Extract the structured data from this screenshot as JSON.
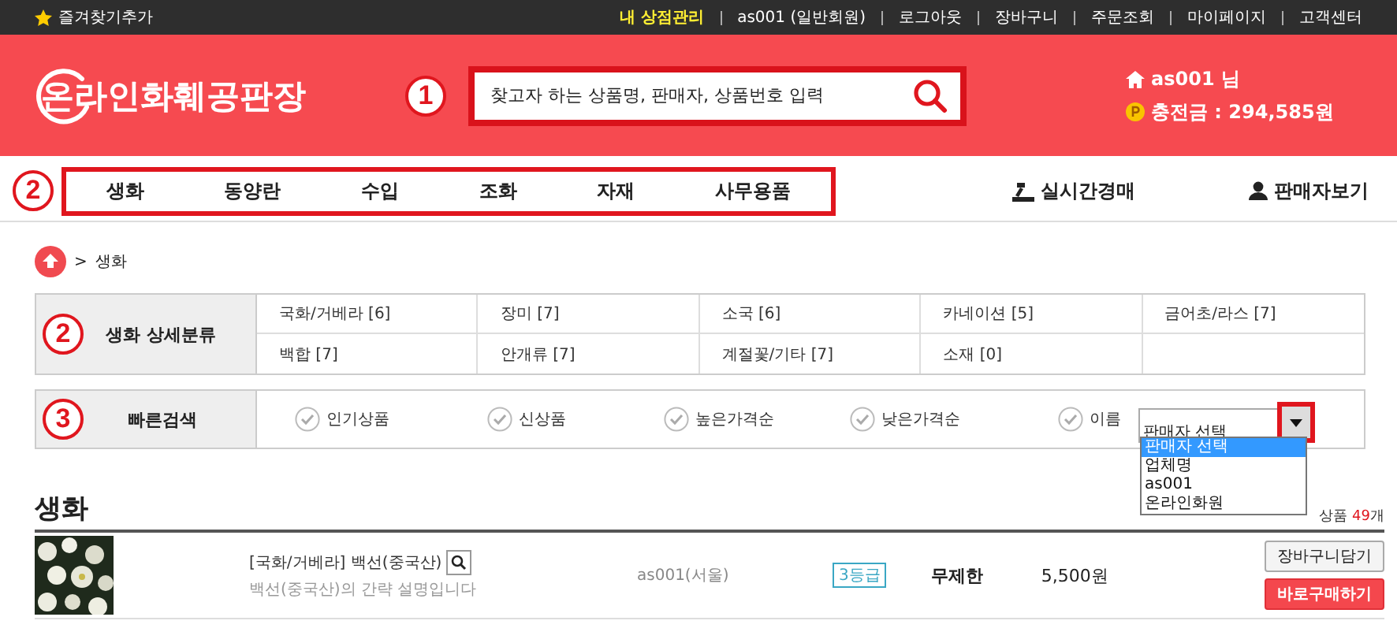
{
  "top_bar": {
    "bookmark": "즐겨찾기추가",
    "links": [
      {
        "label": "내 상점관리",
        "highlight": true
      },
      {
        "label": "as001 (일반회원)",
        "highlight": false
      },
      {
        "label": "로그아웃",
        "highlight": false
      },
      {
        "label": "장바구니",
        "highlight": false
      },
      {
        "label": "주문조회",
        "highlight": false
      },
      {
        "label": "마이페이지",
        "highlight": false
      },
      {
        "label": "고객센터",
        "highlight": false
      }
    ]
  },
  "header": {
    "logo": "온라인화훼공판장",
    "marker": "1",
    "search": {
      "placeholder": "찾고자 하는 상품명, 판매자, 상품번호 입력"
    },
    "user": "as001 님",
    "balance": "충전금 : 294,585원"
  },
  "nav": {
    "marker": "2",
    "items": [
      "생화",
      "동양란",
      "수입",
      "조화",
      "자재",
      "사무용품"
    ],
    "extra": [
      "실시간경매",
      "판매자보기"
    ]
  },
  "breadcrumb": {
    "separator": ">",
    "current": "생화"
  },
  "categories": {
    "marker": "2",
    "title": "생화 상세분류",
    "items": [
      "국화/거베라 [6]",
      "장미 [7]",
      "소국 [6]",
      "카네이션 [5]",
      "금어초/라스 [7]",
      "백합 [7]",
      "안개류 [7]",
      "계절꽃/기타 [7]",
      "소재 [0]"
    ]
  },
  "quick_search": {
    "marker": "3",
    "title": "빠른검색",
    "options": [
      {
        "label": "인기상품",
        "checked": false
      },
      {
        "label": "신상품",
        "checked": false
      },
      {
        "label": "높은가격순",
        "checked": false
      },
      {
        "label": "낮은가격순",
        "checked": false
      },
      {
        "label": "이름",
        "checked": false
      }
    ],
    "seller_select": {
      "value": "판매자 선택",
      "expanded": true,
      "options": [
        {
          "label": "판매자 선택",
          "selected": true
        },
        {
          "label": "업체명",
          "selected": false
        },
        {
          "label": "as001",
          "selected": false
        },
        {
          "label": "온라인화원",
          "selected": false
        }
      ]
    }
  },
  "section": {
    "title": "생화",
    "count": {
      "prefix": "상품 ",
      "number": "49",
      "suffix": "개"
    }
  },
  "products": [
    {
      "name": "[국화/거베라] 백선(중국산)",
      "description": "백선(중국산)의 간략 설명입니다",
      "seller": "as001(서울)",
      "grade": "3등급",
      "period": "무제한",
      "price": "5,500원",
      "buttons": [
        "장바구니담기",
        "바로구매하기"
      ]
    }
  ]
}
